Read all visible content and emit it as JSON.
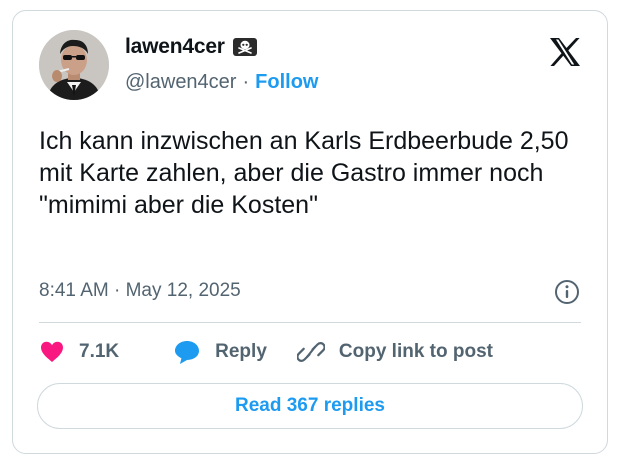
{
  "author": {
    "display_name": "lawen4cer",
    "badge_icon": "skull-crossbones-icon",
    "handle": "@lawen4cer",
    "separator": "·",
    "follow_label": "Follow"
  },
  "tweet": {
    "text": "Ich kann inzwischen an Karls Erdbeerbude 2,50 mit Karte zahlen, aber die Gastro immer noch \"mimimi aber die Kosten\"",
    "timestamp": "8:41 AM · May 12, 2025"
  },
  "actions": {
    "like_count": "7.1K",
    "reply_label": "Reply",
    "copy_link_label": "Copy link to post"
  },
  "read_replies_label": "Read 367 replies",
  "colors": {
    "accent": "#1d9bf0",
    "like": "#f91880",
    "text": "#0f1419",
    "muted": "#536471",
    "border": "#cfd9de"
  }
}
